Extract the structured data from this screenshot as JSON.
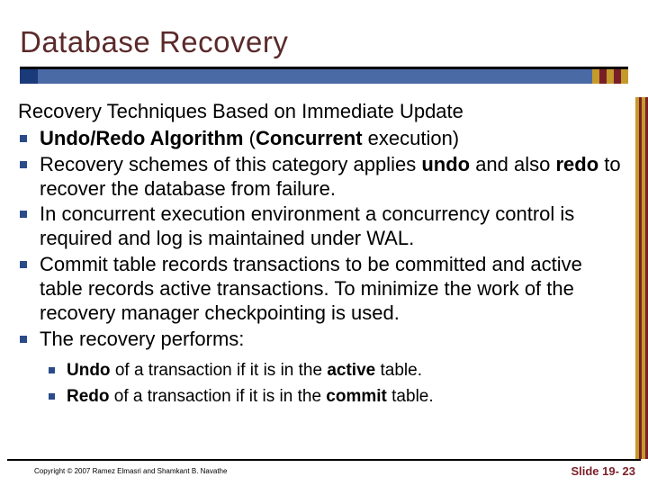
{
  "title": "Database Recovery",
  "section_heading": "Recovery Techniques Based on Immediate Update",
  "bullets": [
    {
      "pre": "",
      "b1": "Undo/Redo Algorithm",
      "mid": " (",
      "b2": "Concurrent",
      "post": " execution)"
    },
    {
      "pre": "Recovery schemes of this category applies ",
      "b1": "undo",
      "mid": " and also ",
      "b2": "redo",
      "post": " to recover the database from failure."
    },
    {
      "pre": " In concurrent execution environment a concurrency control is required and log is maintained under WAL.",
      "b1": "",
      "mid": "",
      "b2": "",
      "post": ""
    },
    {
      "pre": "Commit table records transactions to be committed and active table records active transactions.  To minimize the work of the recovery manager checkpointing is used.",
      "b1": "",
      "mid": "",
      "b2": "",
      "post": ""
    },
    {
      "pre": "The recovery performs:",
      "b1": "",
      "mid": "",
      "b2": "",
      "post": ""
    }
  ],
  "sub_bullets": [
    {
      "b1": "Undo",
      "mid": " of a transaction if it is in the ",
      "b2": "active",
      "post": " table."
    },
    {
      "b1": "Redo",
      "mid": " of a transaction if it is in the ",
      "b2": "commit",
      "post": " table."
    }
  ],
  "footer": {
    "copyright": "Copyright © 2007 Ramez Elmasri and Shamkant B. Navathe",
    "slide": "Slide 19- 23"
  }
}
